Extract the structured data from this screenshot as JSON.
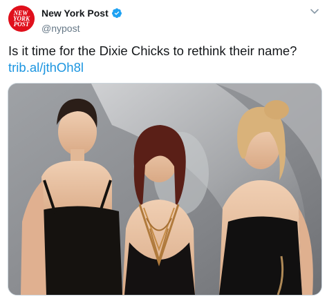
{
  "tweet": {
    "avatar_text": [
      "NEW",
      "YORK",
      "POST"
    ],
    "display_name": "New York Post",
    "handle": "@nypost",
    "verified": true,
    "text_prefix": "Is it time for the Dixie Chicks to rethink their name? ",
    "link_text": "trib.al/jthOh8l",
    "media_icon": "photo-of-three-women",
    "caret_icon": "chevron-down-icon"
  },
  "colors": {
    "brand_red": "#e0101c",
    "link": "#1b95e0",
    "verified": "#1da1f2",
    "handle": "#657786"
  }
}
